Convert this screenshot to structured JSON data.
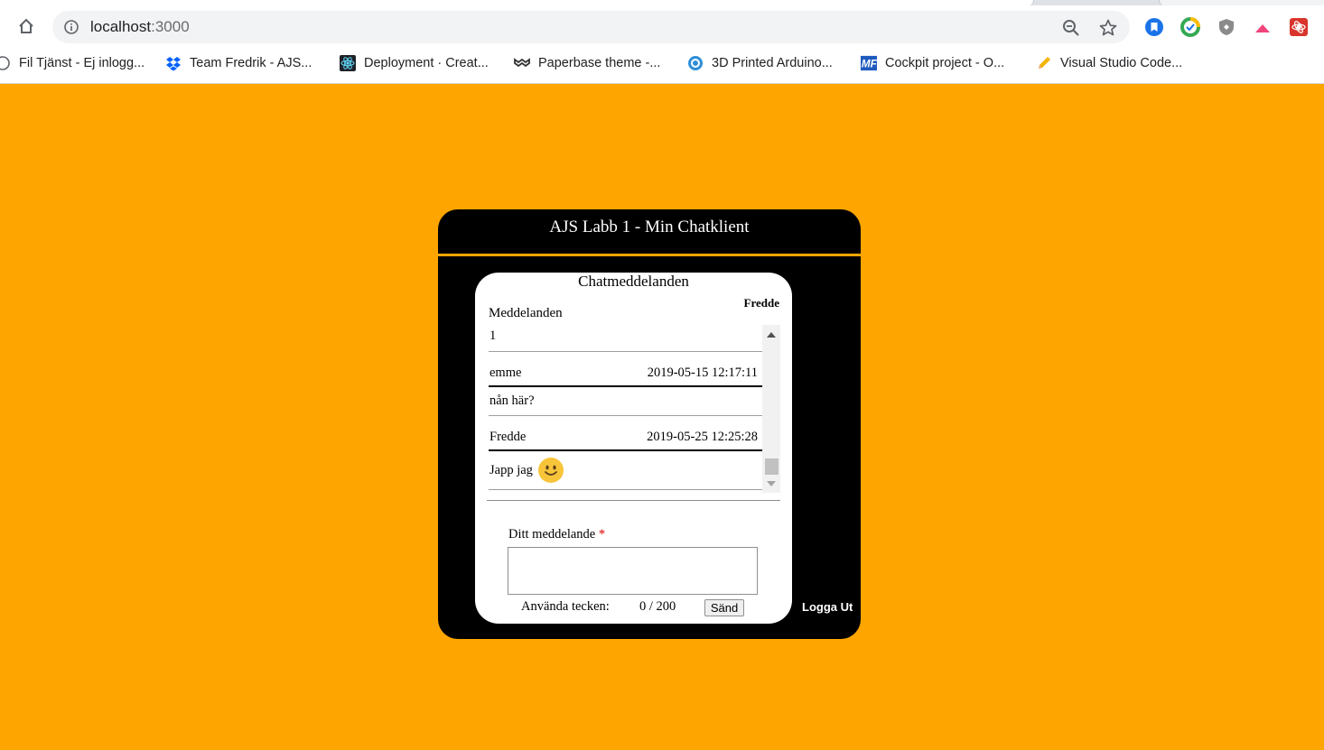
{
  "browser": {
    "url_host": "localhost",
    "url_port": ":3000",
    "icons": {
      "home": "home-icon",
      "info": "info-icon",
      "zoom": "zoom-icon",
      "star": "star-icon"
    },
    "bookmarks": [
      {
        "label": "Fil Tjänst - Ej inlogg...",
        "icon": "globe-icon"
      },
      {
        "label": "Team Fredrik - AJS...",
        "icon": "dropbox-icon"
      },
      {
        "label": "Deployment · Creat...",
        "icon": "react-icon"
      },
      {
        "label": "Paperbase theme -...",
        "icon": "material-ui-icon"
      },
      {
        "label": "3D Printed Arduino...",
        "icon": "pinshape-icon"
      },
      {
        "label": "Cockpit project - O...",
        "icon": "mf-icon"
      },
      {
        "label": "Visual Studio Code...",
        "icon": "pencil-icon"
      }
    ]
  },
  "app": {
    "title": "AJS Labb 1 - Min Chatklient",
    "card_title": "Chatmeddelanden",
    "username": "Fredde",
    "messages_label": "Meddelanden",
    "messages": [
      {
        "text": "1"
      },
      {
        "author": "emme",
        "timestamp": "2019-05-15 12:17:11",
        "text": "nån här?"
      },
      {
        "author": "Fredde",
        "timestamp": "2019-05-25 12:25:28",
        "text": "Japp jag",
        "emoji": "smiley-emoji"
      }
    ],
    "input_label": "Ditt meddelande",
    "required_mark": "*",
    "chars_label": "Använda tecken:",
    "chars_count": "0 / 200",
    "send_label": "Sänd",
    "logout_label": "Logga Ut"
  },
  "colors": {
    "page_background": "#ffa500",
    "app_background": "#000000",
    "card_background": "#ffffff"
  }
}
